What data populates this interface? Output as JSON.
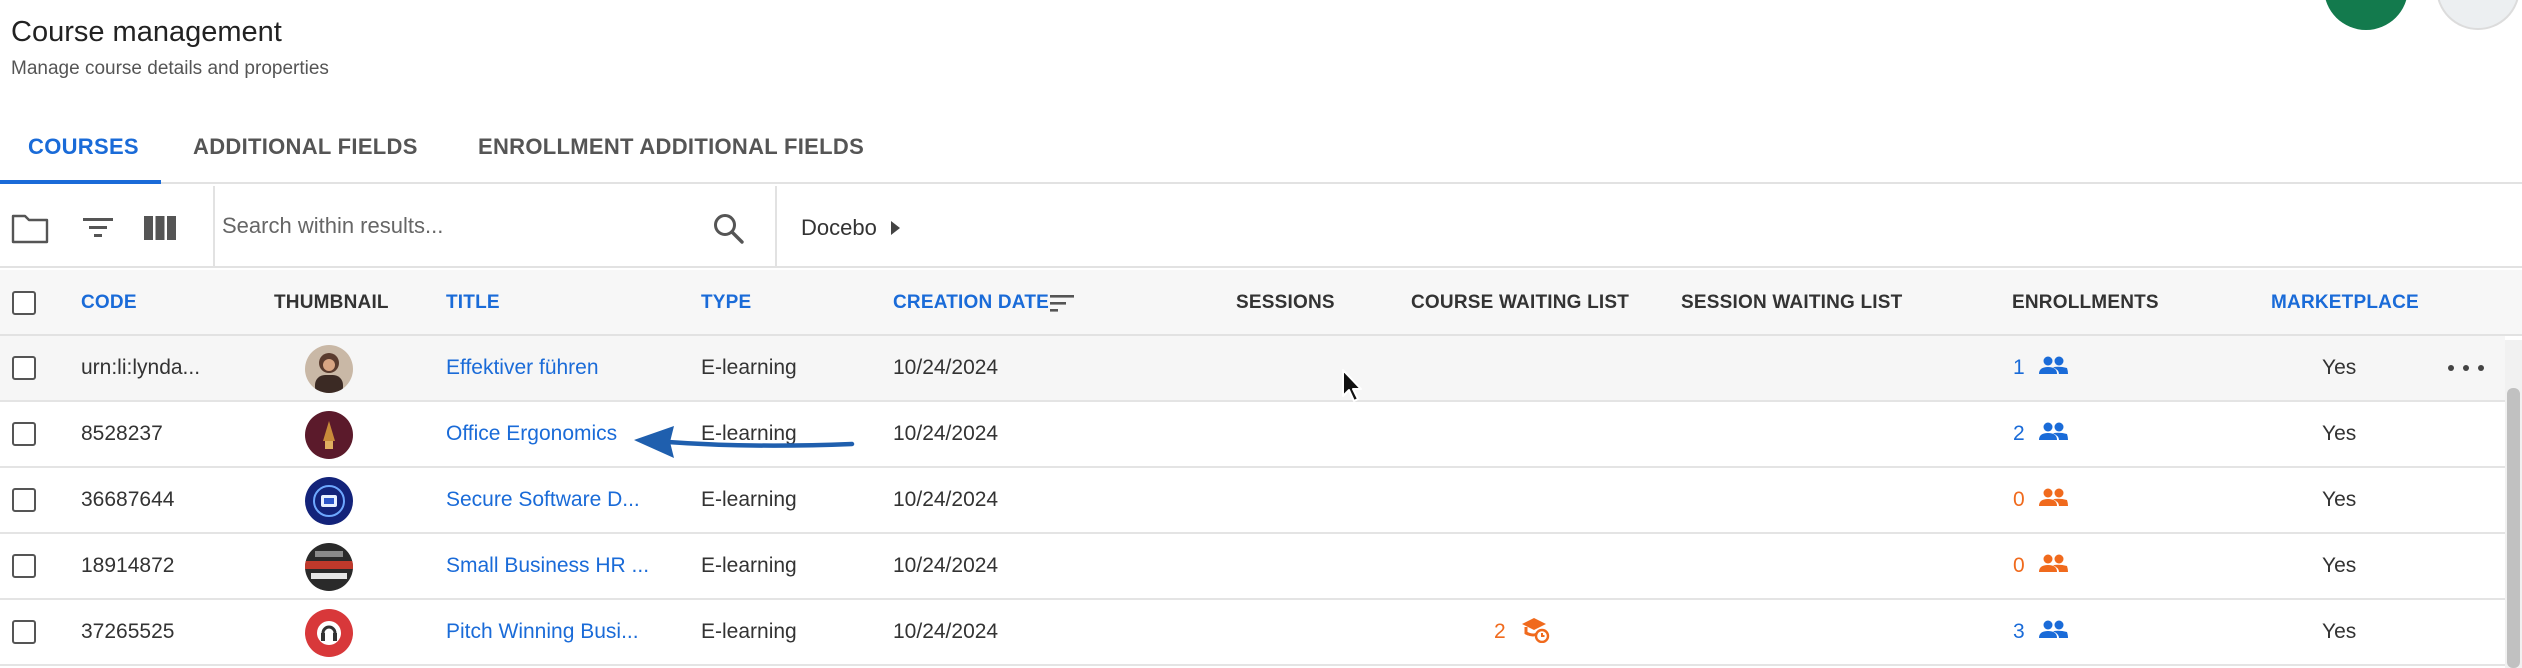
{
  "header": {
    "title": "Course management",
    "subtitle": "Manage course details and properties"
  },
  "tabs": [
    {
      "label": "COURSES",
      "active": true
    },
    {
      "label": "ADDITIONAL FIELDS",
      "active": false
    },
    {
      "label": "ENROLLMENT ADDITIONAL FIELDS",
      "active": false
    }
  ],
  "toolbar": {
    "icons": [
      "folder-icon",
      "filter-icon",
      "columns-icon"
    ],
    "search": {
      "placeholder": "Search within results...",
      "value": ""
    },
    "breadcrumb": "Docebo"
  },
  "table": {
    "columns": [
      {
        "key": "code",
        "label": "CODE",
        "sortable": true
      },
      {
        "key": "thumbnail",
        "label": "THUMBNAIL",
        "sortable": false
      },
      {
        "key": "title",
        "label": "TITLE",
        "sortable": true
      },
      {
        "key": "type",
        "label": "TYPE",
        "sortable": true
      },
      {
        "key": "creation_date",
        "label": "CREATION DATE",
        "sortable": true,
        "sorted": true
      },
      {
        "key": "sessions",
        "label": "SESSIONS",
        "sortable": false
      },
      {
        "key": "course_waiting_list",
        "label": "COURSE WAITING LIST",
        "sortable": false
      },
      {
        "key": "session_waiting_list",
        "label": "SESSION WAITING LIST",
        "sortable": false
      },
      {
        "key": "enrollments",
        "label": "ENROLLMENTS",
        "sortable": false
      },
      {
        "key": "marketplace",
        "label": "MARKETPLACE",
        "sortable": true
      }
    ],
    "rows": [
      {
        "code": "urn:li:lynda...",
        "title": "Effektiver führen",
        "type": "E-learning",
        "creation_date": "10/24/2024",
        "course_waiting_list": "",
        "enrollments": "1",
        "enrollments_status": "active",
        "marketplace": "Yes",
        "thumbnail_icon": "portrait-thumbnail"
      },
      {
        "code": "8528237",
        "title": "Office Ergonomics",
        "type": "E-learning",
        "creation_date": "10/24/2024",
        "course_waiting_list": "",
        "enrollments": "2",
        "enrollments_status": "active",
        "marketplace": "Yes",
        "thumbnail_icon": "maroon-thumbnail"
      },
      {
        "code": "36687644",
        "title": "Secure Software D...",
        "type": "E-learning",
        "creation_date": "10/24/2024",
        "course_waiting_list": "",
        "enrollments": "0",
        "enrollments_status": "empty",
        "marketplace": "Yes",
        "thumbnail_icon": "security-thumbnail"
      },
      {
        "code": "18914872",
        "title": "Small Business HR ...",
        "type": "E-learning",
        "creation_date": "10/24/2024",
        "course_waiting_list": "",
        "enrollments": "0",
        "enrollments_status": "empty",
        "marketplace": "Yes",
        "thumbnail_icon": "business-thumbnail"
      },
      {
        "code": "37265525",
        "title": "Pitch Winning Busi...",
        "type": "E-learning",
        "creation_date": "10/24/2024",
        "course_waiting_list": "2",
        "enrollments": "3",
        "enrollments_status": "active",
        "marketplace": "Yes",
        "thumbnail_icon": "pitch-thumbnail"
      }
    ]
  },
  "colors": {
    "accent": "#1a6bd8",
    "warning": "#f06a1d",
    "annotation_arrow": "#1f5fae",
    "avatar_green": "#137a4d"
  }
}
